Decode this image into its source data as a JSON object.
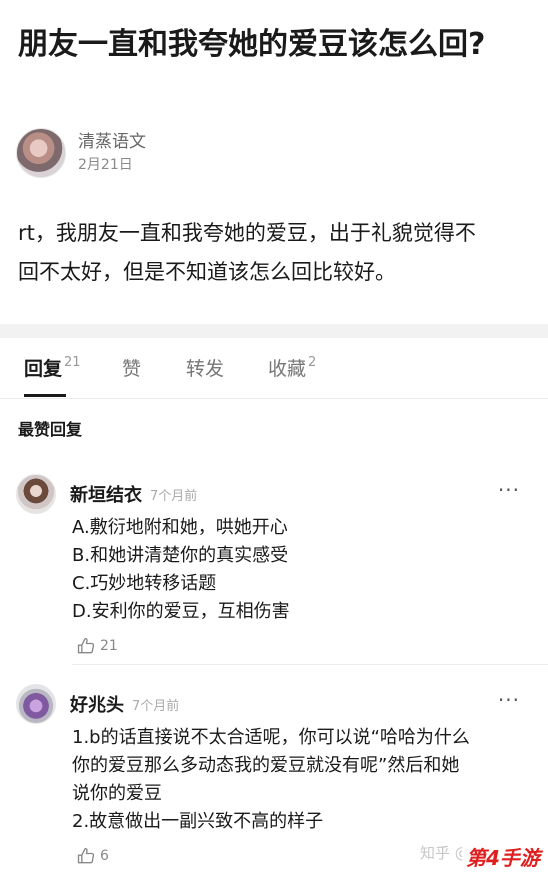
{
  "question": {
    "title": "朋友一直和我夸她的爱豆该怎么回?",
    "author": "清蒸语文",
    "date": "2月21日",
    "body_lines": [
      "rt，我朋友一直和我夸她的爱豆，出于礼貌觉得不",
      "回不太好，但是不知道该怎么回比较好。"
    ]
  },
  "tabs": [
    {
      "label": "回复",
      "count": "21",
      "active": true
    },
    {
      "label": "赞",
      "count": ""
    },
    {
      "label": "转发",
      "count": ""
    },
    {
      "label": "收藏",
      "count": "2"
    }
  ],
  "section_label": "最赞回复",
  "comments": [
    {
      "name": "新垣结衣",
      "time": "7个月前",
      "lines": [
        "A.敷衍地附和她，哄她开心",
        "B.和她讲清楚你的真实感受",
        "C.巧妙地转移话题",
        "D.安利你的爱豆，互相伤害"
      ],
      "likes": "21"
    },
    {
      "name": "好兆头",
      "time": "7个月前",
      "lines": [
        "1.b的话直接说不太合适呢，你可以说“哈哈为什么",
        "你的爱豆那么多动态我的爱豆就没有呢”然后和她",
        "说你的爱豆",
        "2.故意做出一副兴致不高的样子"
      ],
      "likes": "6"
    }
  ],
  "watermark": "知乎 @",
  "brand_badge": "第4手游",
  "more_icon": "···",
  "colors": {
    "brand": "#e02020",
    "text": "#1a1a1a",
    "muted": "#8a8a8a"
  }
}
